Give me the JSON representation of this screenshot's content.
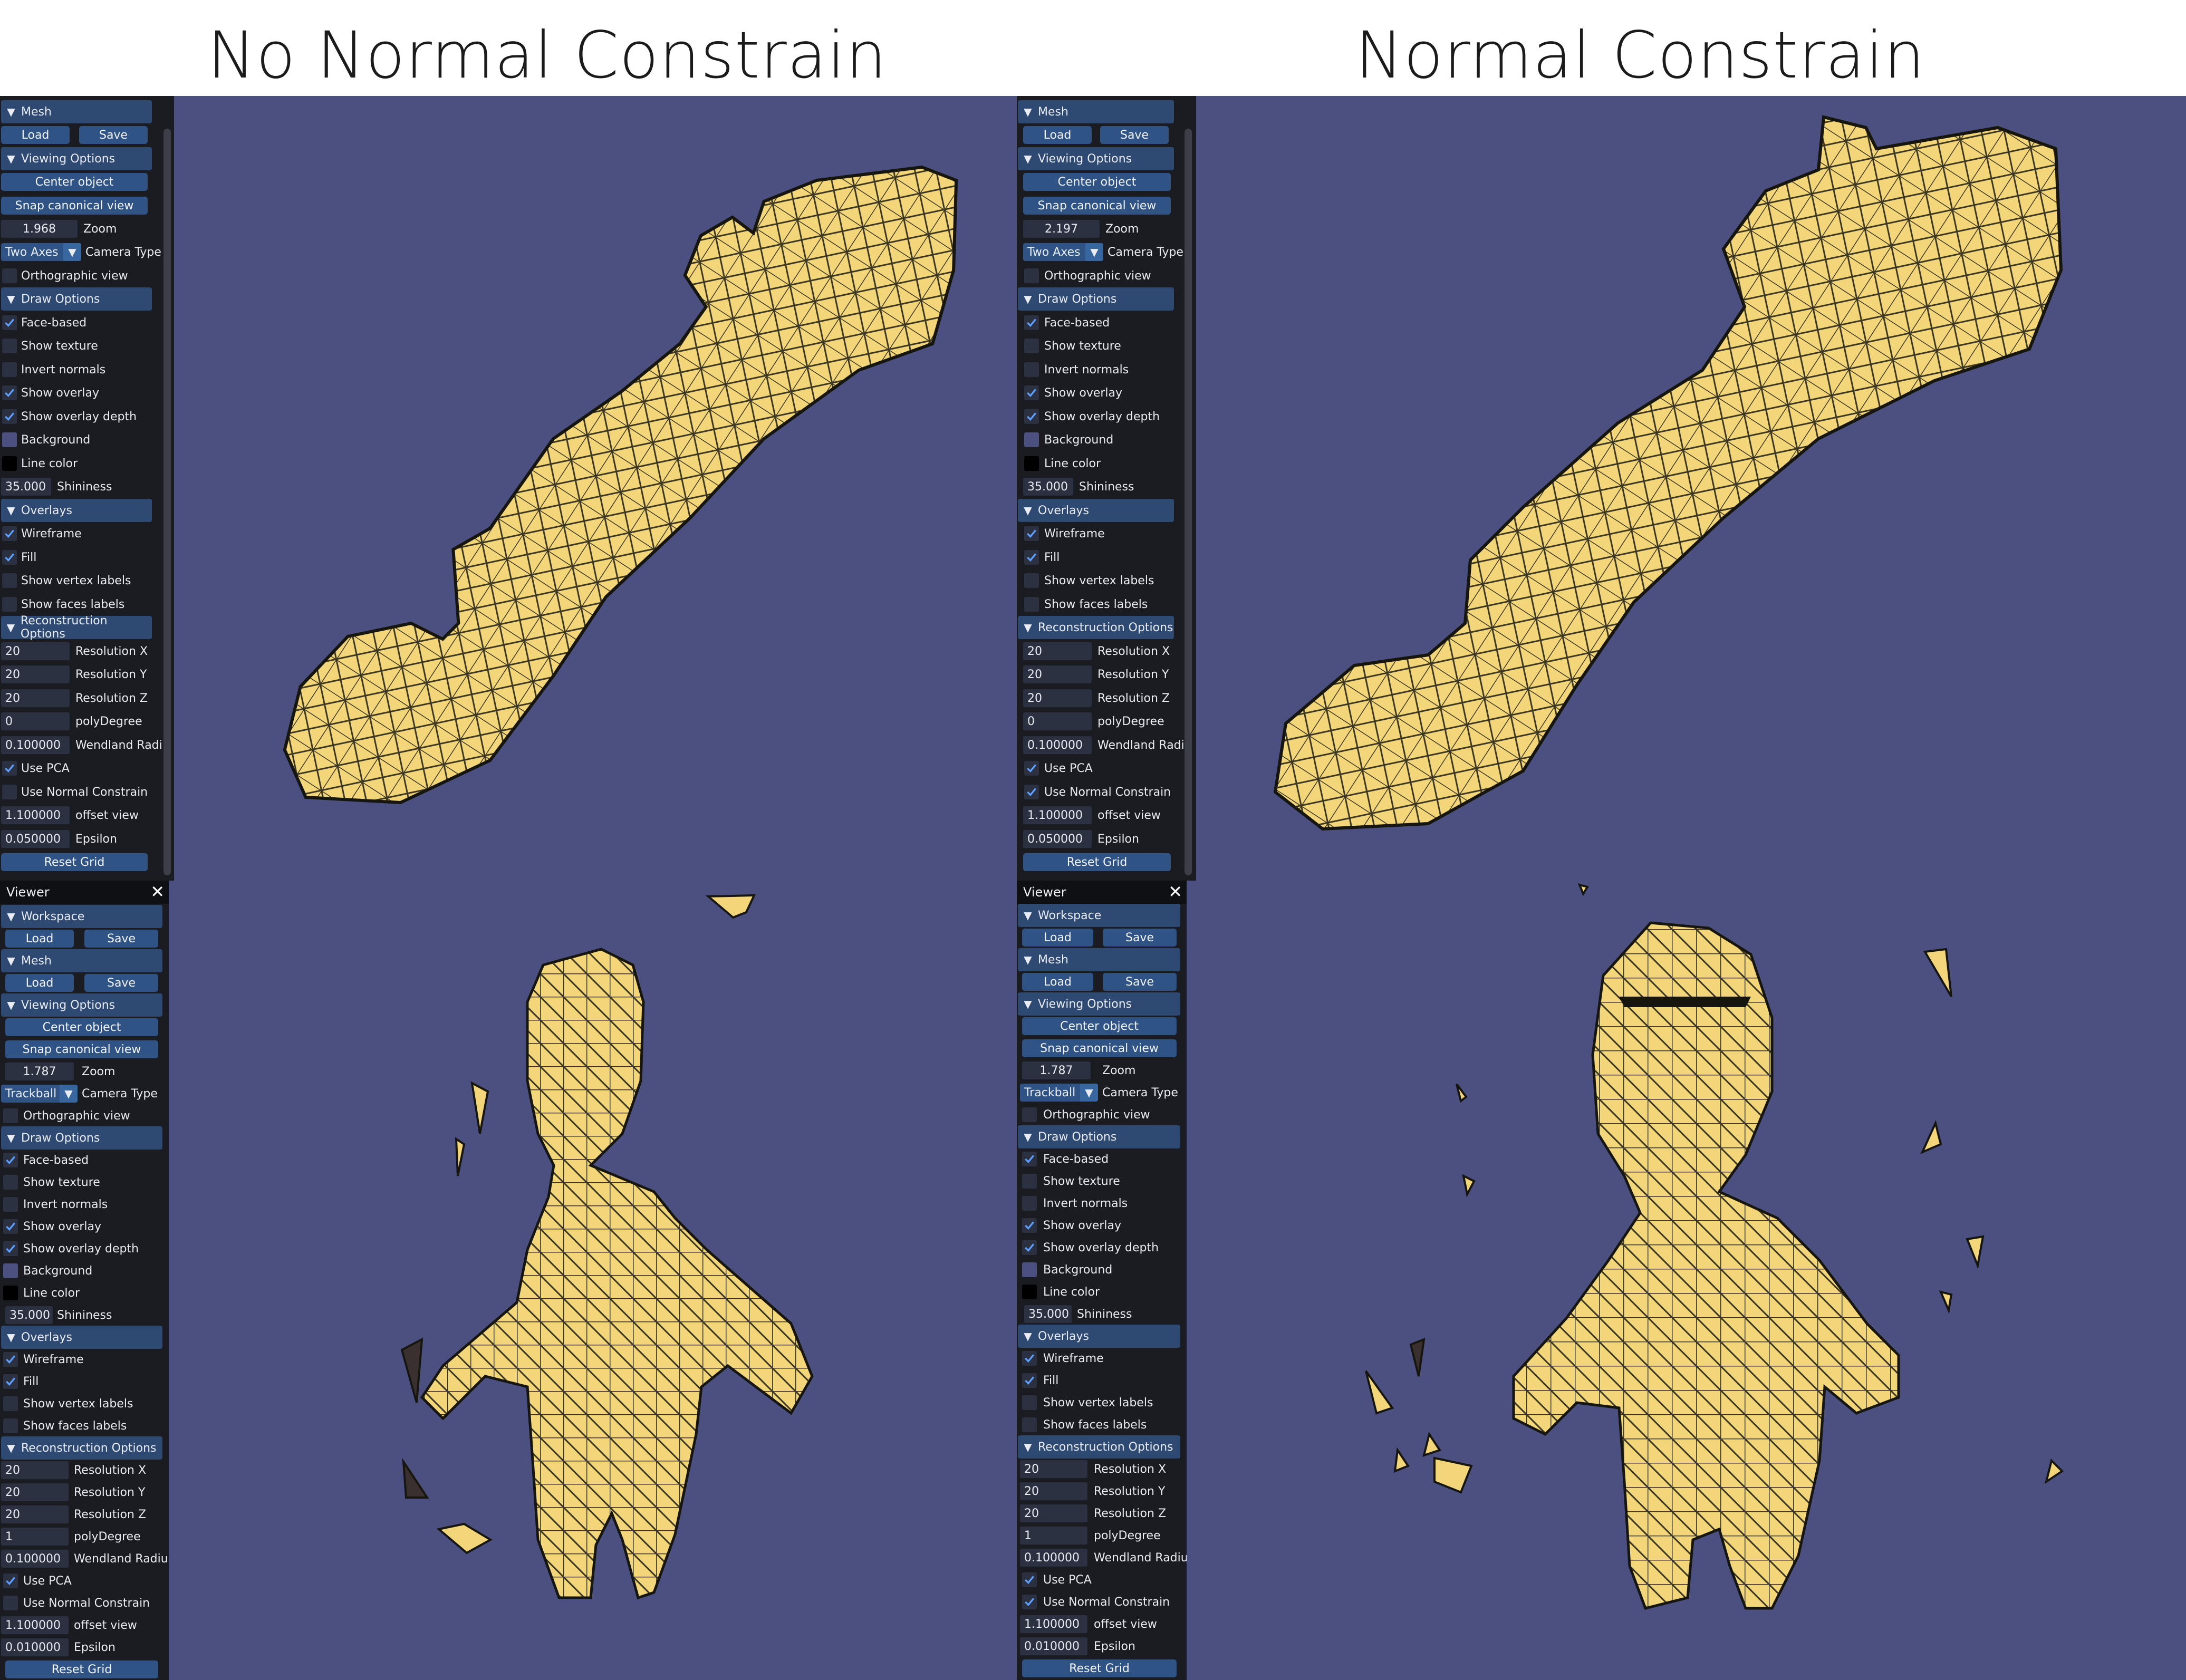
{
  "titles": {
    "left": "No Normal Constrain",
    "right": "Normal Constrain"
  },
  "colors": {
    "viewport_bg": "#4b5080",
    "panel_bg": "#1a1c21",
    "header": "#2e4a73",
    "button": "#2e5384",
    "mesh_fill": "#f4d67a",
    "mesh_edge": "#1a1a12",
    "background_swatch": "#4b5080",
    "line_swatch": "#000000"
  },
  "icons": {
    "collapse": "triangle-down-icon",
    "close": "close-icon",
    "check": "checkmark-icon",
    "dropdown": "dropdown-arrow-icon"
  },
  "labels": {
    "mesh": "Mesh",
    "workspace": "Workspace",
    "viewer": "Viewer",
    "load": "Load",
    "save": "Save",
    "viewing_options": "Viewing Options",
    "center_object": "Center object",
    "snap_view": "Snap canonical view",
    "zoom": "Zoom",
    "camera_type": "Camera Type",
    "ortho": "Orthographic view",
    "draw_options": "Draw Options",
    "face_based": "Face-based",
    "show_texture": "Show texture",
    "invert_normals": "Invert normals",
    "show_overlay": "Show overlay",
    "show_overlay_depth": "Show overlay depth",
    "background": "Background",
    "line_color": "Line color",
    "shininess": "Shininess",
    "overlays": "Overlays",
    "wireframe": "Wireframe",
    "fill": "Fill",
    "show_vertex_labels": "Show vertex labels",
    "show_faces_labels": "Show faces labels",
    "reconstruction_options": "Reconstruction Options",
    "res_x": "Resolution X",
    "res_y": "Resolution Y",
    "res_z": "Resolution Z",
    "poly_degree": "polyDegree",
    "wendland_short": "Wendland Radi",
    "wendland_long": "Wendland Radius I",
    "use_pca": "Use PCA",
    "use_normal_constrain": "Use Normal Constrain",
    "offset_view": "offset view",
    "epsilon": "Epsilon",
    "reset_grid": "Reset Grid"
  },
  "panels": {
    "top_left": {
      "zoom": "1.968",
      "camera": "Two Axes",
      "shininess": "35.000",
      "res_x": "20",
      "res_y": "20",
      "res_z": "20",
      "poly_degree": "0",
      "wendland": "0.100000",
      "offset": "1.100000",
      "epsilon": "0.050000",
      "use_normal_constrain": false
    },
    "top_right": {
      "zoom": "2.197",
      "camera": "Two Axes",
      "shininess": "35.000",
      "res_x": "20",
      "res_y": "20",
      "res_z": "20",
      "poly_degree": "0",
      "wendland": "0.100000",
      "offset": "1.100000",
      "epsilon": "0.050000",
      "use_normal_constrain": true
    },
    "bottom_left": {
      "zoom": "1.787",
      "camera": "Trackball",
      "shininess": "35.000",
      "res_x": "20",
      "res_y": "20",
      "res_z": "20",
      "poly_degree": "1",
      "wendland": "0.100000",
      "offset": "1.100000",
      "epsilon": "0.010000",
      "use_normal_constrain": false
    },
    "bottom_right": {
      "zoom": "1.787",
      "camera": "Trackball",
      "shininess": "35.000",
      "res_x": "20",
      "res_y": "20",
      "res_z": "20",
      "poly_degree": "1",
      "wendland": "0.100000",
      "offset": "1.100000",
      "epsilon": "0.010000",
      "use_normal_constrain": true
    }
  }
}
